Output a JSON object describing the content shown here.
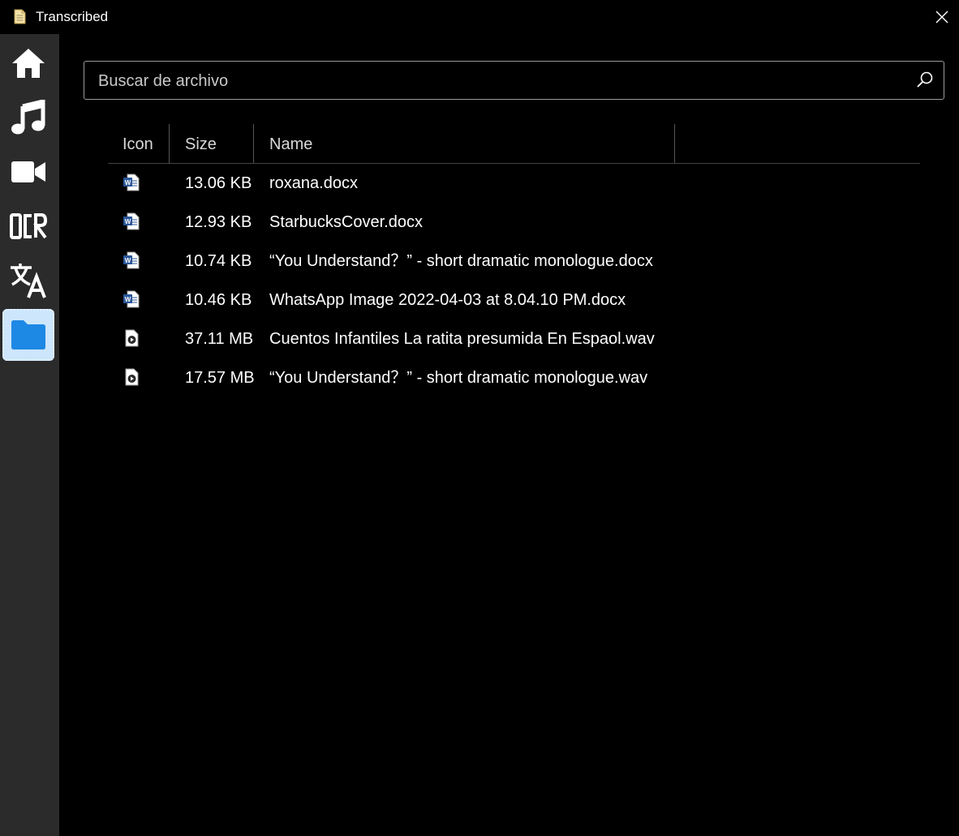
{
  "window": {
    "title": "Transcribed",
    "app_icon": "document-icon",
    "close_icon": "close-icon"
  },
  "sidebar": {
    "items": [
      {
        "name": "home",
        "icon": "home-icon"
      },
      {
        "name": "music",
        "icon": "music-note-icon"
      },
      {
        "name": "video",
        "icon": "video-camera-icon"
      },
      {
        "name": "ocr",
        "icon": "ocr-icon",
        "text": "OCR"
      },
      {
        "name": "translate",
        "icon": "translate-icon"
      },
      {
        "name": "files",
        "icon": "folder-icon",
        "active": true
      }
    ],
    "active_color": "#cde6fb",
    "folder_color": "#1e88e5"
  },
  "search": {
    "placeholder": "Buscar de archivo",
    "value": "",
    "icon": "search-icon"
  },
  "table": {
    "columns": [
      "Icon",
      "Size",
      "Name"
    ],
    "rows": [
      {
        "icon": "word-document-icon",
        "size": "13.06 KB",
        "name": "roxana.docx"
      },
      {
        "icon": "word-document-icon",
        "size": "12.93 KB",
        "name": "StarbucksCover.docx"
      },
      {
        "icon": "word-document-icon",
        "size": "10.74 KB",
        "name": "“You Understand？” - short dramatic monologue.docx"
      },
      {
        "icon": "word-document-icon",
        "size": "10.46 KB",
        "name": "WhatsApp Image 2022-04-03 at 8.04.10 PM.docx"
      },
      {
        "icon": "audio-file-icon",
        "size": "37.11 MB",
        "name": "Cuentos Infantiles La ratita presumida En Espaol.wav"
      },
      {
        "icon": "audio-file-icon",
        "size": "17.57 MB",
        "name": "“You Understand？” - short dramatic monologue.wav"
      }
    ]
  }
}
